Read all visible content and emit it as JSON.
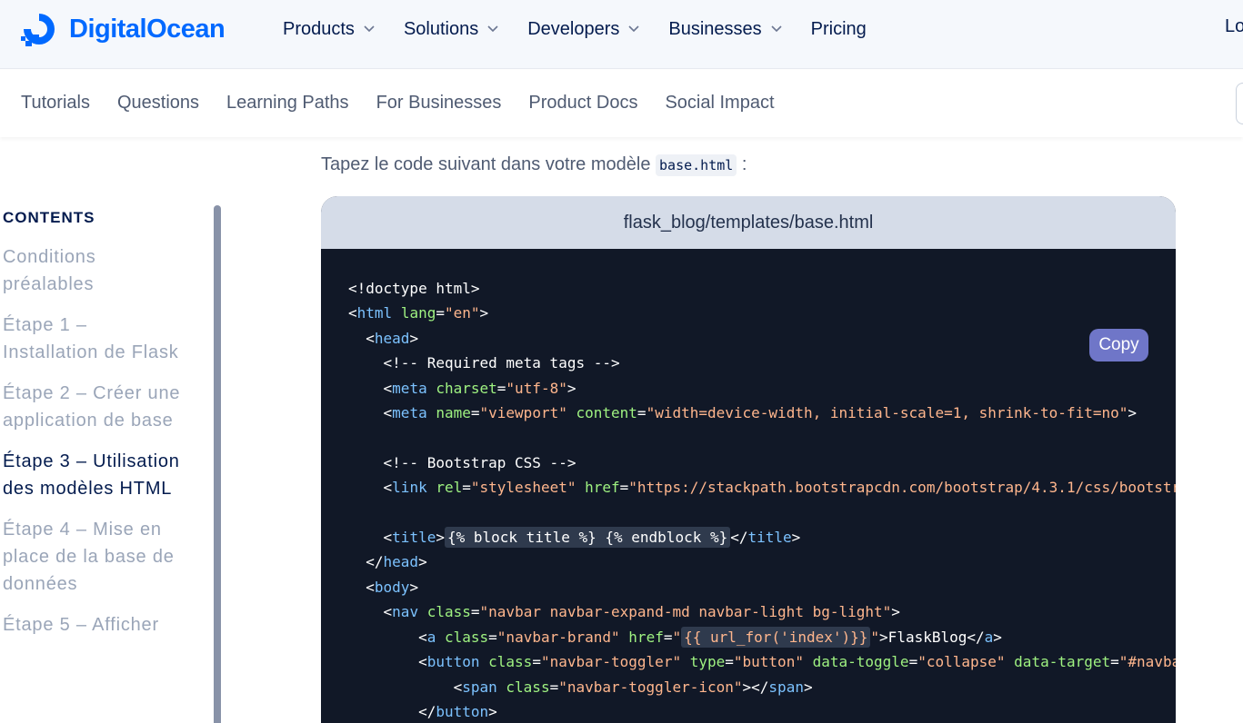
{
  "brand": {
    "name": "DigitalOcean",
    "color": "#0069ff"
  },
  "topnav": {
    "items": [
      {
        "label": "Products",
        "dropdown": true
      },
      {
        "label": "Solutions",
        "dropdown": true
      },
      {
        "label": "Developers",
        "dropdown": true
      },
      {
        "label": "Businesses",
        "dropdown": true
      },
      {
        "label": "Pricing",
        "dropdown": false
      }
    ],
    "login_label": "Lo"
  },
  "subnav": {
    "items": [
      "Tutorials",
      "Questions",
      "Learning Paths",
      "For Businesses",
      "Product Docs",
      "Social Impact"
    ]
  },
  "sidebar": {
    "title": "CONTENTS",
    "items": [
      {
        "label": "Conditions préalables",
        "active": false
      },
      {
        "label": "Étape 1 – Installation de Flask",
        "active": false
      },
      {
        "label": "Étape 2 – Créer une application de base",
        "active": false
      },
      {
        "label": "Étape 3 – Utilisation des modèles HTML",
        "active": true
      },
      {
        "label": "Étape 4 – Mise en place de la base de données",
        "active": false
      },
      {
        "label": "Étape 5 – Afficher",
        "active": false
      }
    ]
  },
  "main": {
    "intro_text": "Tapez le code suivant dans votre modèle",
    "intro_code": "base.html",
    "intro_suffix": " :",
    "code_filename": "flask_blog/templates/base.html",
    "copy_label": "Copy"
  }
}
